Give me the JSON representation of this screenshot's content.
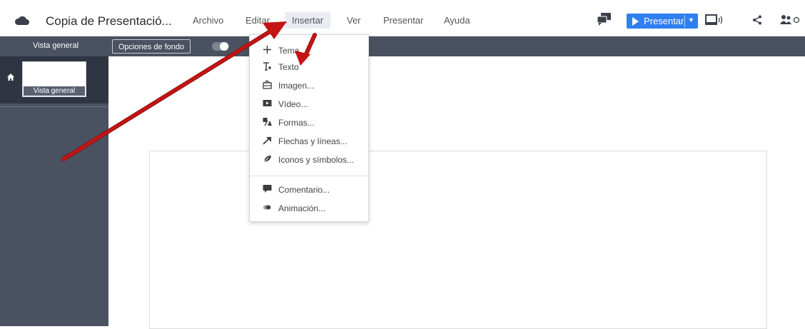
{
  "app": {
    "title": "Copia de Presentació...",
    "menu": [
      "Archivo",
      "Editar",
      "Insertar",
      "Ver",
      "Presentar",
      "Ayuda"
    ],
    "active_menu": "Insertar",
    "present_label": "Presentar",
    "accent": "#2f7ff0"
  },
  "toolbar": {
    "overview_label": "Vista general",
    "background_button": "Opciones de fondo"
  },
  "sidebar": {
    "slide_label": "Vista general"
  },
  "dropdown": {
    "items": [
      {
        "label": "Tema",
        "icon": "plus-icon"
      },
      {
        "label": "Texto",
        "icon": "text-icon"
      },
      {
        "label": "Imagen...",
        "icon": "image-icon"
      },
      {
        "label": "Vídeo...",
        "icon": "video-icon"
      },
      {
        "label": "Formas...",
        "icon": "shapes-icon"
      },
      {
        "label": "Flechas y líneas...",
        "icon": "arrow-icon"
      },
      {
        "label": "Iconos y símbolos...",
        "icon": "leaf-icon"
      },
      {
        "label": "Comentario...",
        "icon": "comment-icon"
      },
      {
        "label": "Animación...",
        "icon": "animation-icon"
      }
    ]
  },
  "annotation": {
    "arrow_color": "#c41414"
  }
}
